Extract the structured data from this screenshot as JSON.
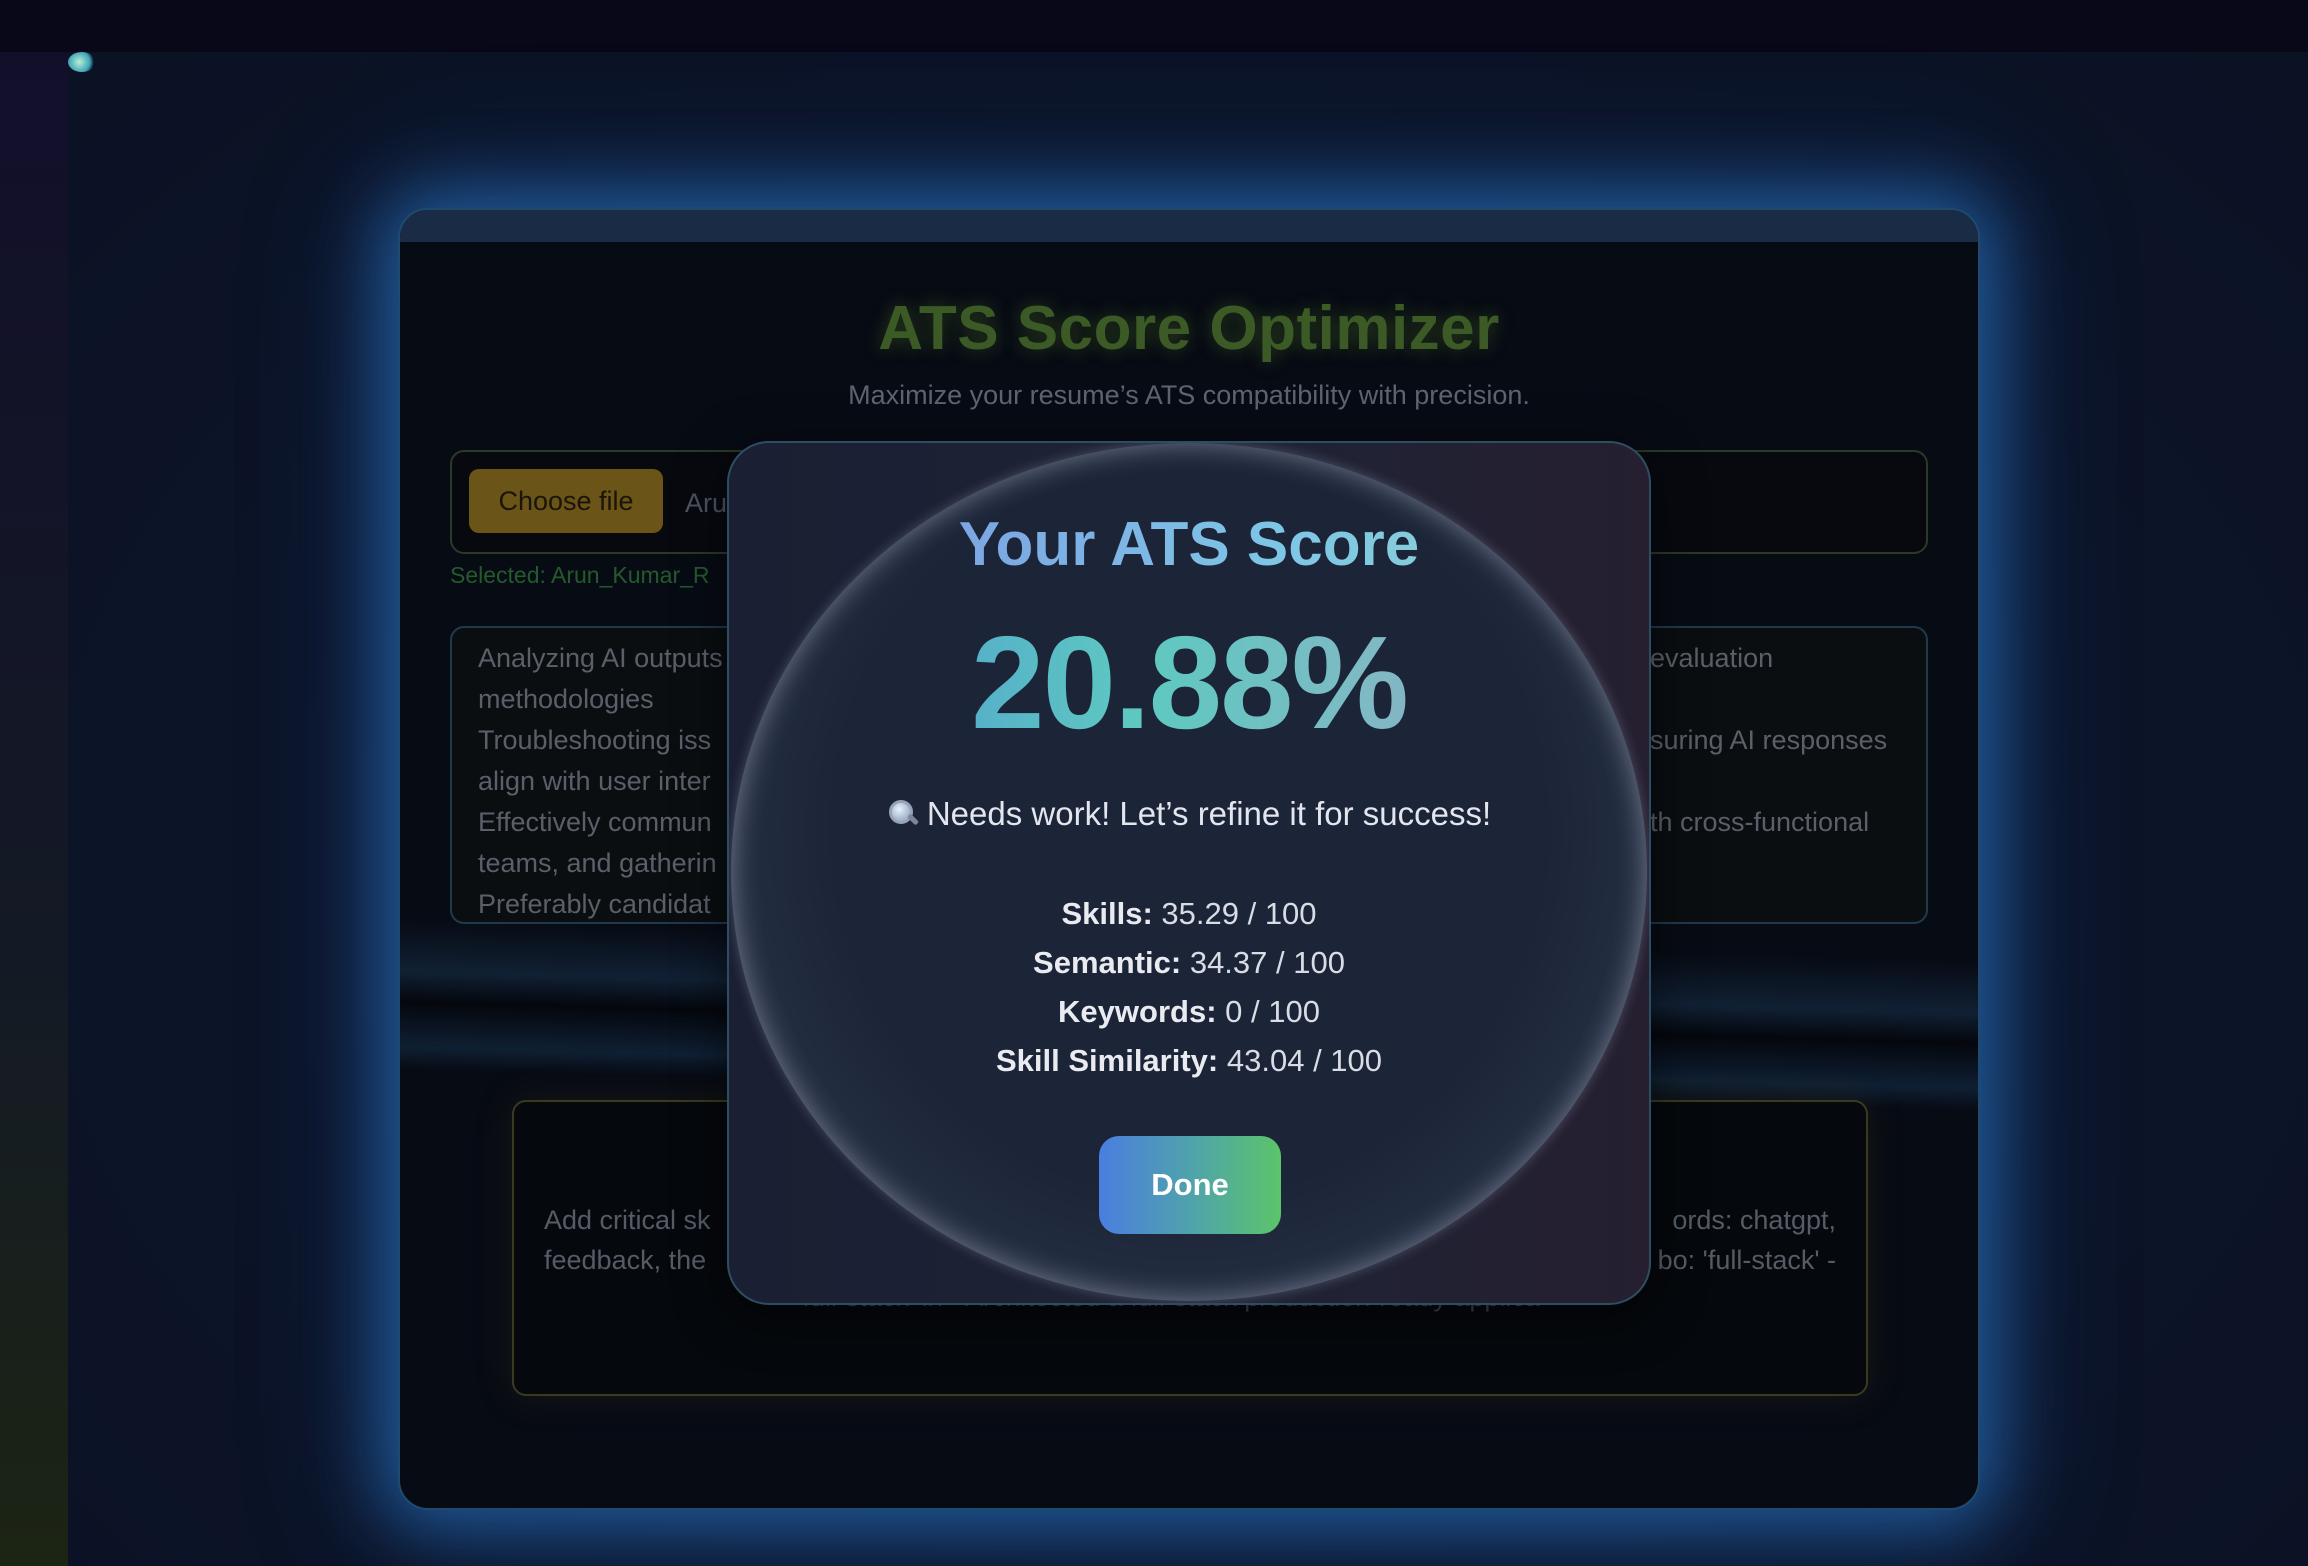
{
  "app": {
    "title": "ATS Score Optimizer",
    "subtitle": "Maximize your resume’s ATS compatibility with precision."
  },
  "upload": {
    "choose_file_label": "Choose file",
    "file_name_visible": "Aru",
    "selected_text": "Selected: Arun_Kumar_R"
  },
  "job_description": {
    "left_lines": [
      "Analyzing AI outputs",
      "methodologies",
      "Troubleshooting iss",
      "align with user inter",
      "Effectively commun",
      "teams, and gatherin",
      "Preferably candidat"
    ],
    "right_lines": [
      "evaluation",
      "",
      "suring AI responses",
      "",
      "th cross-functional",
      "",
      ""
    ]
  },
  "suggestions": {
    "left_lines": [
      "Add critical sk",
      "feedback, the"
    ],
    "right_lines": [
      "ords: chatgpt,",
      "bo: 'full-stack' -"
    ],
    "bottom_line": "> 'full-stack' in - Architected a full-stack production-ready applica"
  },
  "modal": {
    "title": "Your ATS Score",
    "score": "20.88%",
    "verdict_icon": "magnifying-glass-icon",
    "verdict": "Needs work! Let’s refine it for success!",
    "metrics": [
      {
        "label": "Skills:",
        "value": "35.29 / 100"
      },
      {
        "label": "Semantic:",
        "value": "34.37 / 100"
      },
      {
        "label": "Keywords:",
        "value": "0 / 100"
      },
      {
        "label": "Skill Similarity:",
        "value": "43.04 / 100"
      }
    ],
    "done_label": "Done"
  },
  "colors": {
    "card_glow": "#2e88e2",
    "title_green": "#3c5a26",
    "score_gradient_start": "#4c8fd6",
    "score_gradient_mid": "#5ec9c0",
    "done_gradient_start": "#4a7ee0",
    "done_gradient_end": "#5cc46a"
  }
}
